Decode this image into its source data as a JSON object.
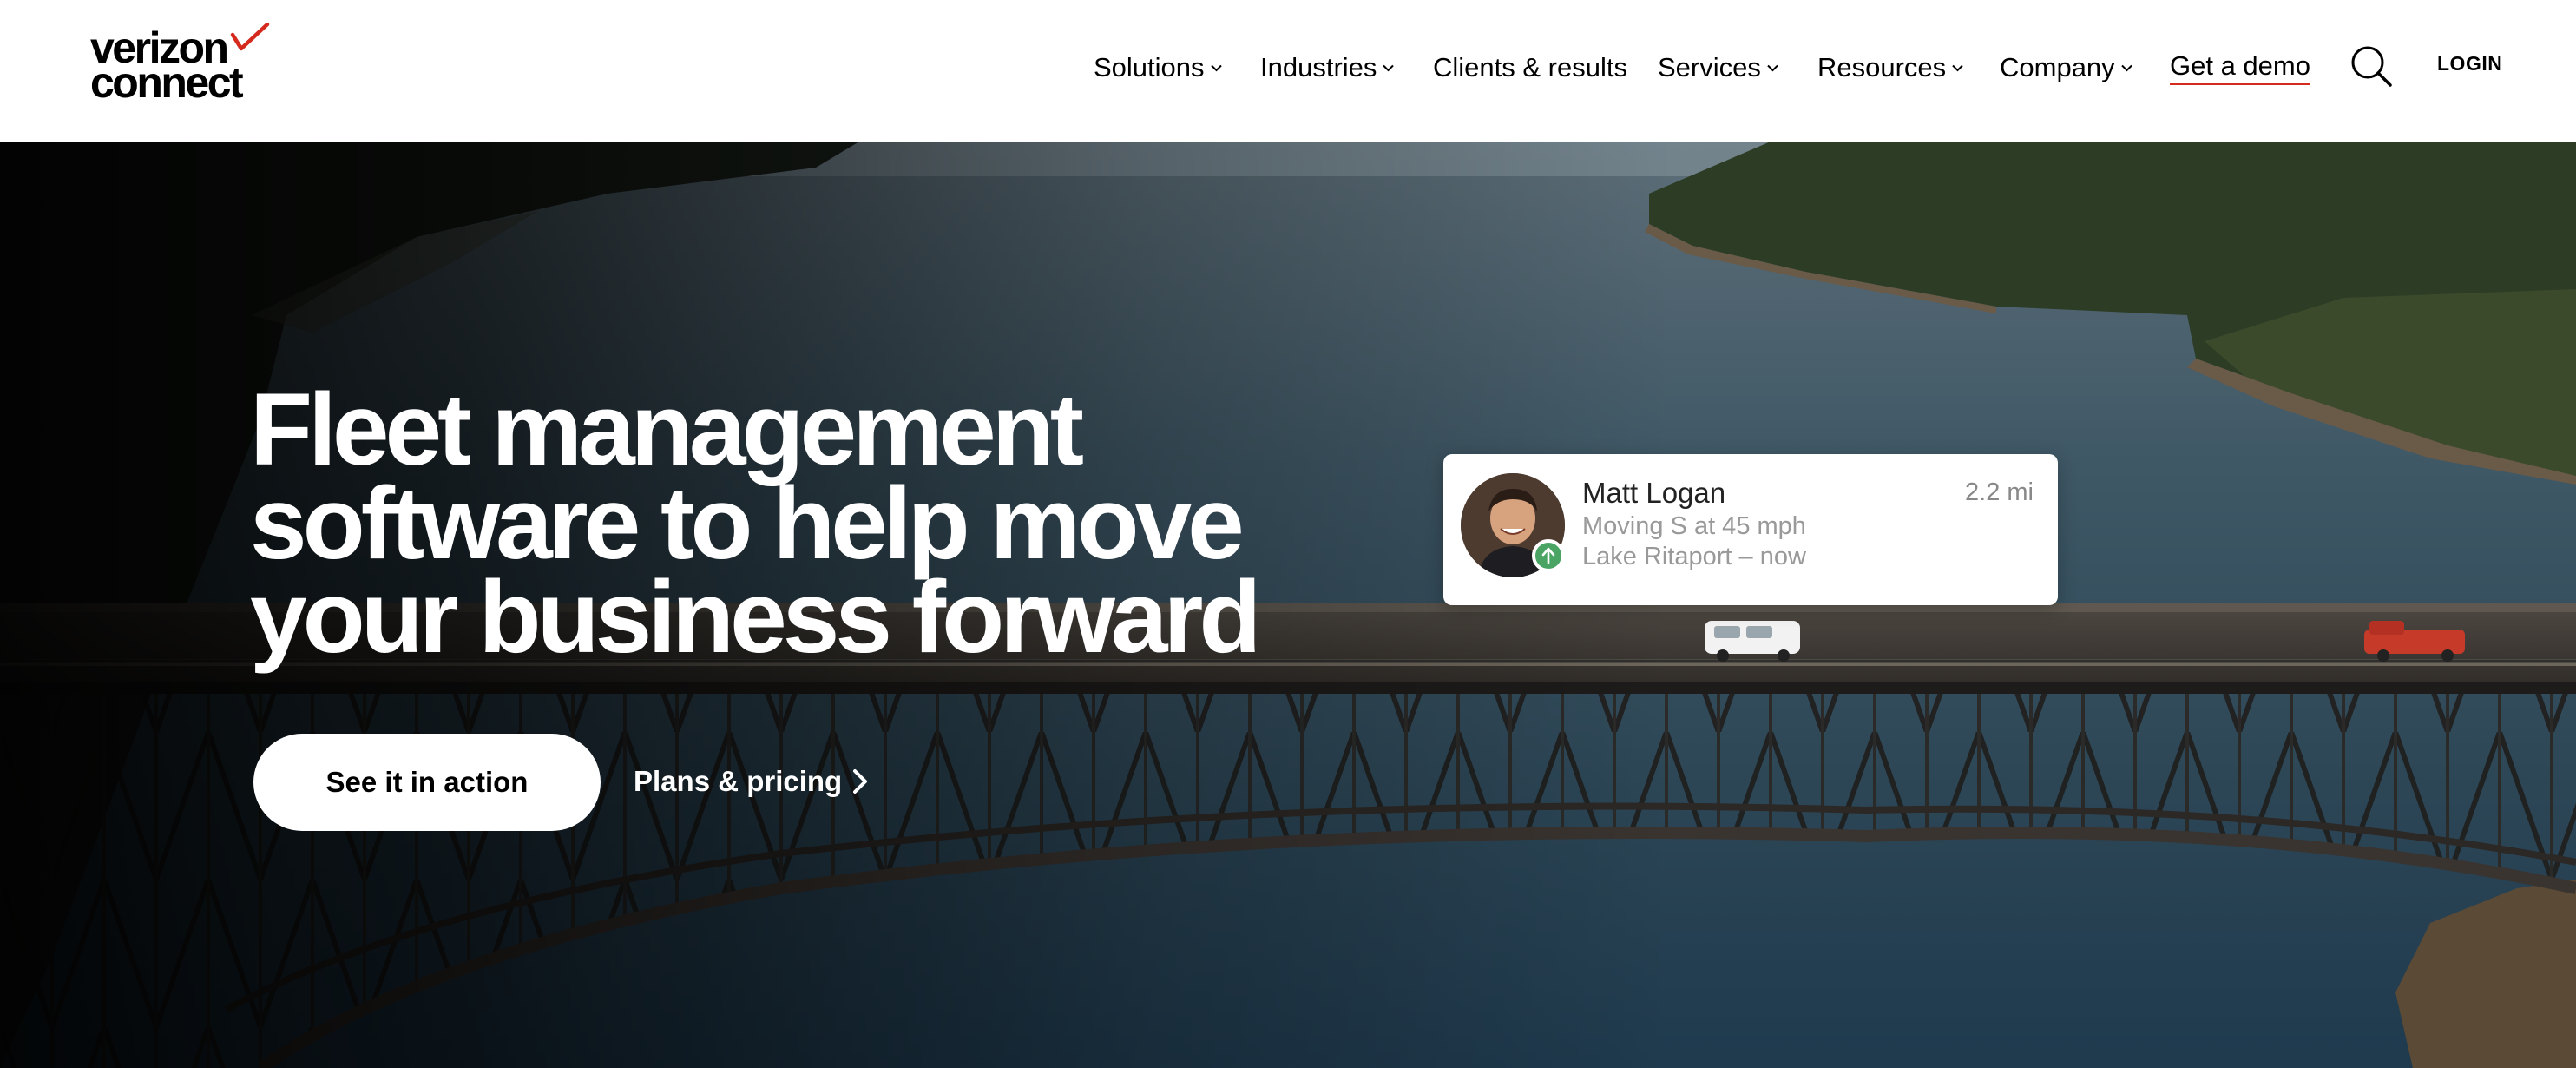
{
  "brand": {
    "logo_line1": "verizon",
    "logo_line2": "connect",
    "accent_color": "#d52b1e"
  },
  "nav": {
    "items": [
      {
        "label": "Solutions",
        "has_dropdown": true
      },
      {
        "label": "Industries",
        "has_dropdown": true
      },
      {
        "label": "Clients & results",
        "has_dropdown": false
      },
      {
        "label": "Services",
        "has_dropdown": true
      },
      {
        "label": "Resources",
        "has_dropdown": true
      },
      {
        "label": "Company",
        "has_dropdown": true
      }
    ],
    "demo_label": "Get a demo",
    "search_icon": "search-icon",
    "login_label": "LOGIN"
  },
  "hero": {
    "headline_lines": [
      "Fleet management",
      "software to help move",
      "your business forward"
    ],
    "primary_cta": "See it in action",
    "secondary_cta": "Plans & pricing",
    "background": "aerial view of truss bridge over water with forested shores"
  },
  "tracking_card": {
    "driver_name": "Matt Logan",
    "distance": "2.2 mi",
    "status": "Moving S at 45 mph",
    "location": "Lake Ritaport – now",
    "status_color": "#4aa564"
  }
}
